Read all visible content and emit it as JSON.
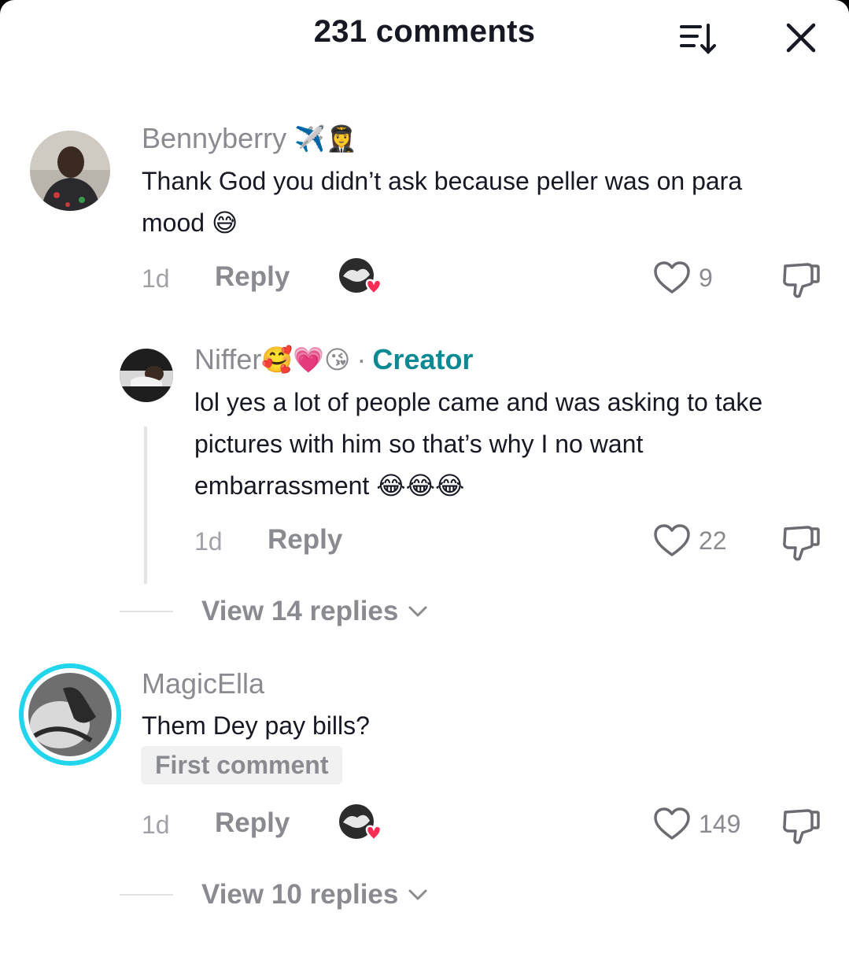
{
  "header": {
    "title": "231 comments",
    "sort_icon": "sort-descending-icon",
    "close_icon": "close-icon"
  },
  "comments": [
    {
      "username": "Bennyberry",
      "username_emojis": "✈️👩‍✈️",
      "text_line1": "Thank God you didn’t ask because peller was on para",
      "text_line2": "mood",
      "text_emoji": "😅",
      "time": "1d",
      "reply_label": "Reply",
      "likes": "9",
      "creator_liked": true
    },
    {
      "username": "Niffer",
      "username_emojis": "🥰💗😘",
      "creator_label": "Creator",
      "separator": "·",
      "text_line1": "lol yes a lot of people came and was asking to take",
      "text_line2": "pictures with him so that’s why I no want",
      "text_line3": "embarrassment",
      "text_emoji": "😂😂😂",
      "time": "1d",
      "reply_label": "Reply",
      "likes": "22"
    },
    {
      "username": "MagicElla",
      "text_line1": "Them Dey pay bills?",
      "badge": "First comment",
      "time": "1d",
      "reply_label": "Reply",
      "likes": "149",
      "creator_liked": true
    }
  ],
  "view_replies": [
    {
      "label": "View 14 replies"
    },
    {
      "label": "View 10 replies"
    }
  ],
  "colors": {
    "text_primary": "#161823",
    "text_secondary": "#8a8b91",
    "creator": "#0b8a94",
    "heart": "#fe2c55",
    "story_ring": "#20d5ec"
  }
}
